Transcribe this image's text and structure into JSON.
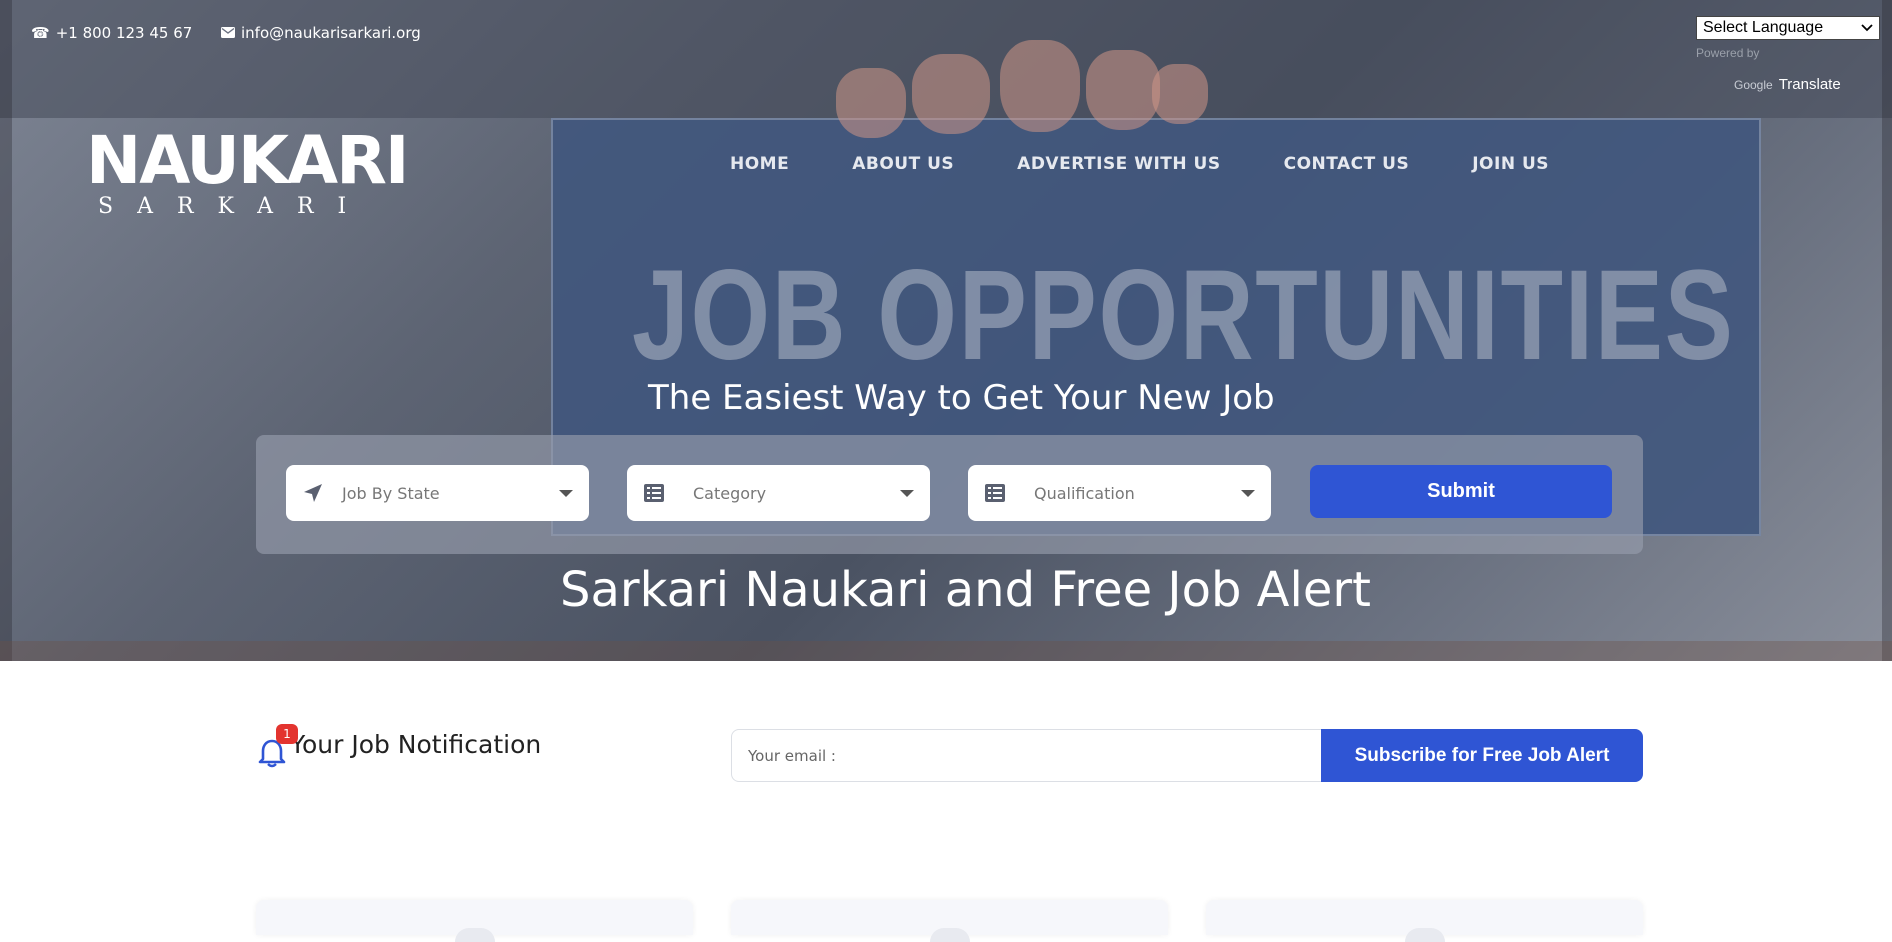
{
  "topbar": {
    "phone_icon": "phone-icon",
    "phone": "+1 800 123 45 67",
    "email_icon": "envelope-icon",
    "email": "info@naukarisarkari.org"
  },
  "translate": {
    "select_label": "Select Language",
    "powered_by": "Powered by",
    "google_word": "Google",
    "translate_word": "Translate"
  },
  "logo": {
    "main": "NAUKARI",
    "sub": "SARKARI"
  },
  "nav": {
    "items": [
      {
        "label": "HOME"
      },
      {
        "label": "ABOUT US"
      },
      {
        "label": "ADVERTISE WITH US"
      },
      {
        "label": "CONTACT US"
      },
      {
        "label": "JOIN US"
      }
    ]
  },
  "hero": {
    "background_text": "JOB OPPORTUNITIES",
    "tagline": "The Easiest Way to Get Your New Job",
    "headline": "Sarkari Naukari and Free Job Alert"
  },
  "search": {
    "state": {
      "label": "Job By State",
      "icon": "location-arrow-icon"
    },
    "category": {
      "label": "Category",
      "icon": "list-icon"
    },
    "qualification": {
      "label": "Qualification",
      "icon": "list-icon"
    },
    "submit_label": "Submit"
  },
  "notification": {
    "bell_icon": "bell-icon",
    "count": "1",
    "title": "Your Job Notification"
  },
  "subscribe": {
    "placeholder": "Your email :",
    "button_label": "Subscribe for Free Job Alert"
  },
  "colors": {
    "accent": "#2f55d4",
    "badge": "#e3342f"
  }
}
